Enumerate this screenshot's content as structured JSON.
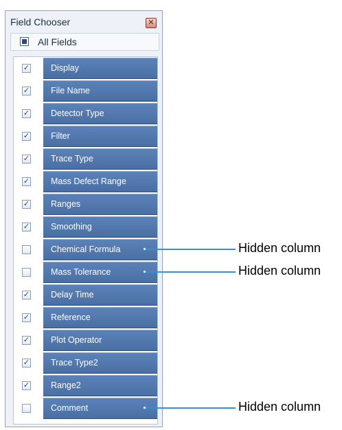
{
  "panel": {
    "title": "Field Chooser",
    "close_glyph": "✕",
    "all_fields": {
      "label": "All Fields",
      "state": "indeterminate"
    }
  },
  "fields": [
    {
      "label": "Display",
      "checked": true
    },
    {
      "label": "File Name",
      "checked": true
    },
    {
      "label": "Detector Type",
      "checked": true
    },
    {
      "label": "Filter",
      "checked": true
    },
    {
      "label": "Trace Type",
      "checked": true
    },
    {
      "label": "Mass Defect Range",
      "checked": true
    },
    {
      "label": "Ranges",
      "checked": true
    },
    {
      "label": "Smoothing",
      "checked": true
    },
    {
      "label": "Chemical Formula",
      "checked": false
    },
    {
      "label": "Mass Tolerance",
      "checked": false
    },
    {
      "label": "Delay Time",
      "checked": true
    },
    {
      "label": "Reference",
      "checked": true
    },
    {
      "label": "Plot Operator",
      "checked": true
    },
    {
      "label": "Trace Type2",
      "checked": true
    },
    {
      "label": "Range2",
      "checked": true
    },
    {
      "label": "Comment",
      "checked": false
    }
  ],
  "callouts": [
    {
      "text": "Hidden column",
      "field": "Chemical Formula"
    },
    {
      "text": "Hidden column",
      "field": "Mass Tolerance"
    },
    {
      "text": "Hidden column",
      "field": "Comment"
    }
  ],
  "colors": {
    "bar": "#4f75ab",
    "callout_line": "#3a8fd1"
  },
  "check_glyph": "✓"
}
